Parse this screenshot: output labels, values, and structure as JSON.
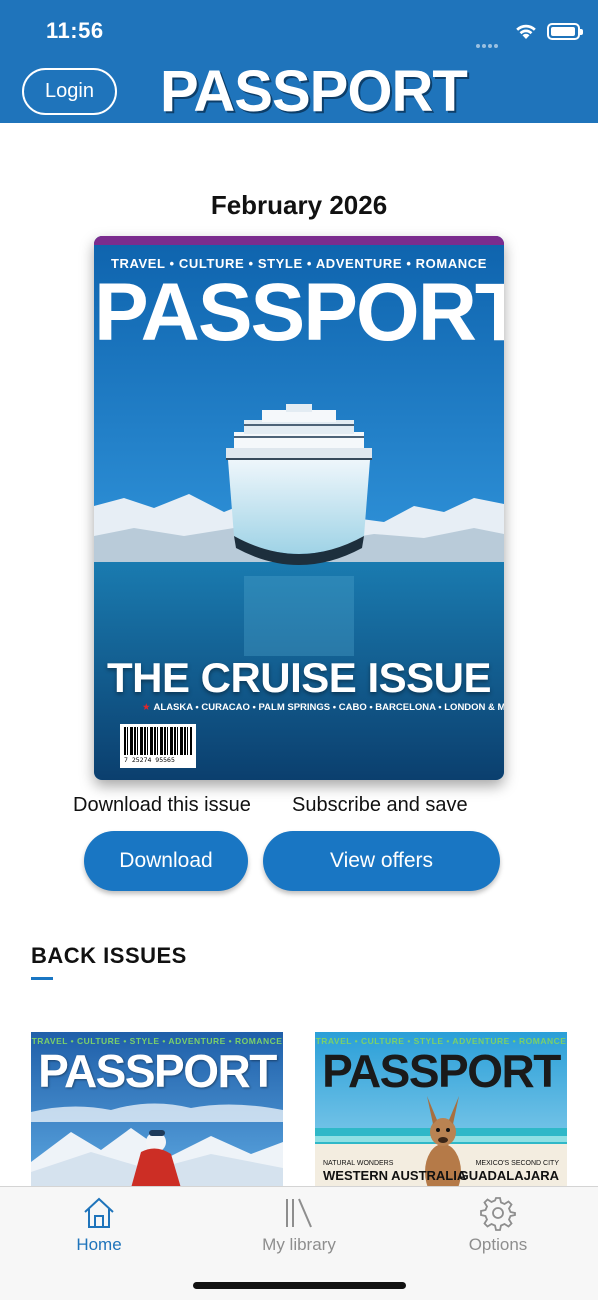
{
  "status_bar": {
    "time": "11:56"
  },
  "header": {
    "login_label": "Login",
    "brand": "PASSPORT",
    "brand_color": "#1f74bb"
  },
  "featured": {
    "issue_date": "February 2026",
    "cover": {
      "tagline": "TRAVEL • CULTURE • STYLE • ADVENTURE • ROMANCE",
      "brand": "PASSPORT",
      "headline": "THE CRUISE ISSUE",
      "destinations": "ALASKA • CURACAO • PALM SPRINGS • CABO • BARCELONA • LONDON & MORE!",
      "barcode_number": "7 25274 95565"
    },
    "download_caption": "Download this issue",
    "subscribe_caption": "Subscribe and save",
    "download_button": "Download",
    "offers_button": "View offers"
  },
  "back_issues": {
    "title": "BACK ISSUES",
    "items": [
      {
        "tagline": "TRAVEL • CULTURE • STYLE • ADVENTURE • ROMANCE",
        "brand": "PASSPORT"
      },
      {
        "tagline": "TRAVEL • CULTURE • STYLE • ADVENTURE • ROMANCE",
        "brand": "PASSPORT",
        "left_small": "NATURAL WONDERS",
        "left_big": "WESTERN AUSTRALIA",
        "right_small": "MEXICO'S SECOND CITY",
        "right_big": "GUADALAJARA"
      }
    ]
  },
  "tabbar": {
    "tabs": [
      {
        "label": "Home",
        "icon": "house-icon",
        "active": true
      },
      {
        "label": "My library",
        "icon": "library-icon",
        "active": false
      },
      {
        "label": "Options",
        "icon": "gear-icon",
        "active": false
      }
    ],
    "active_color": "#1f74bb",
    "inactive_color": "#8e8e8e"
  }
}
